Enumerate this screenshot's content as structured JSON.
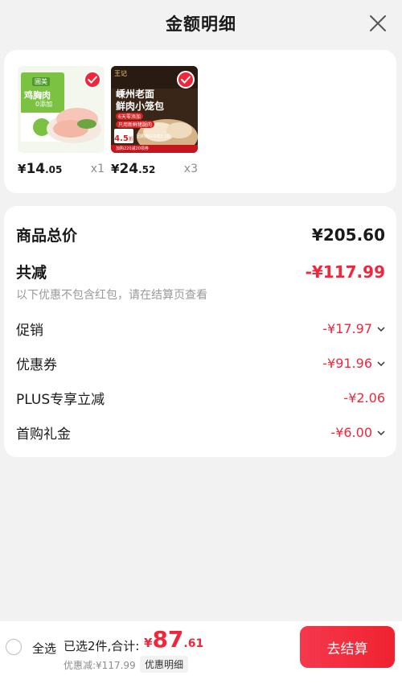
{
  "header": {
    "title": "金额明细"
  },
  "products": [
    {
      "thumb_text": "鸡胸肉",
      "thumb_badge": "圃美",
      "thumb_sub": "0添加",
      "price_yen": "¥",
      "price_int": "14",
      "price_dec": ".05",
      "qty": "x1"
    },
    {
      "thumb_brand": "王记",
      "thumb_line1": "嵊州老面",
      "thumb_line2": "鲜肉小笼包",
      "thumb_tag1": "6天零添加",
      "thumb_tag2": "只用新鲜猪腿肉",
      "thumb_price": "4.5",
      "thumb_unit": "折",
      "thumb_foot1": "团购满100享5.3折",
      "thumb_foot2": "加购220减20领券",
      "price_yen": "¥",
      "price_int": "24",
      "price_dec": ".52",
      "qty": "x3"
    }
  ],
  "summary": {
    "total_label": "商品总价",
    "total_value": "¥205.60",
    "reduce_label": "共减",
    "reduce_value": "-¥117.99",
    "note": "以下优惠不包含红包，请在结算页查看",
    "items": [
      {
        "label": "促销",
        "value": "-¥17.97",
        "expandable": true
      },
      {
        "label": "优惠券",
        "value": "-¥91.96",
        "expandable": true
      },
      {
        "label": "PLUS专享立减",
        "value": "-¥2.06",
        "expandable": false
      },
      {
        "label": "首购礼金",
        "value": "-¥6.00",
        "expandable": true
      }
    ]
  },
  "footer": {
    "select_all": "全选",
    "selected_info": "已选2件,合计:",
    "amount_yen": "¥",
    "amount_int": "87",
    "amount_dec": ".61",
    "discount": "优惠减:¥117.99",
    "detail_button": "优惠明细",
    "checkout": "去结算"
  },
  "colors": {
    "accent": "#f2263a",
    "background": "#f2f2f2"
  }
}
